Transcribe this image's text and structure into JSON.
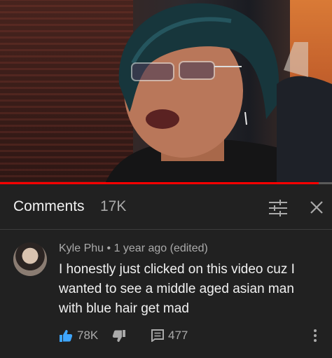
{
  "video": {
    "progress_fraction": 0.96
  },
  "comments_panel": {
    "title": "Comments",
    "count": "17K"
  },
  "comment": {
    "author": "Kyle Phu",
    "separator": "•",
    "time": "1 year ago (edited)",
    "text": "I honestly just clicked on this video cuz I wanted to see a middle aged asian man with blue hair get mad",
    "likes": "78K",
    "replies": "477"
  },
  "colors": {
    "background": "#212121",
    "accent_like": "#3ea6ff",
    "progress": "#ff0000"
  },
  "icons": [
    "filter-icon",
    "close-icon",
    "thumbs-up-icon",
    "thumbs-down-icon",
    "reply-icon",
    "more-vertical-icon"
  ]
}
